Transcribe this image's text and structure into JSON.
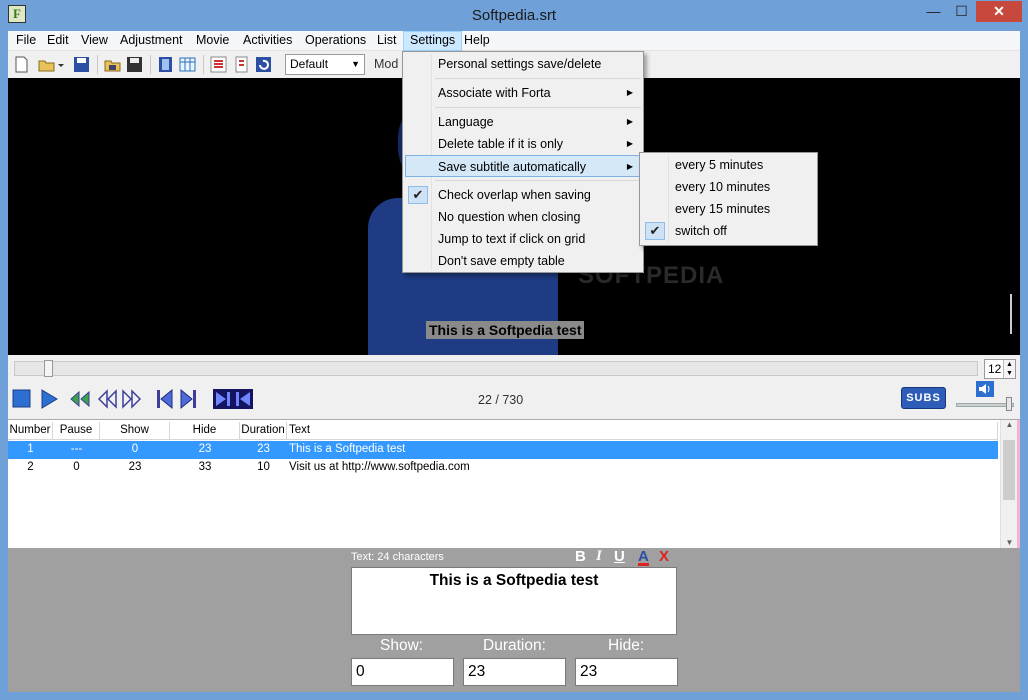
{
  "window": {
    "title": "Softpedia.srt",
    "app_icon": "F",
    "controls": {
      "minimize": "—",
      "maximize": "☐",
      "close": "✕"
    }
  },
  "menubar": {
    "items": [
      "File",
      "Edit",
      "View",
      "Adjustment",
      "Movie",
      "Activities",
      "Operations",
      "List",
      "Settings",
      "Help"
    ],
    "active": "Settings"
  },
  "toolbar": {
    "icons": [
      "new-file-icon",
      "open-folder-icon",
      "save-icon",
      "open-movie-icon",
      "save-as-icon",
      "film-icon",
      "table-icon",
      "list-icon",
      "list-small-icon",
      "undo-icon"
    ],
    "style_select": "Default",
    "mode_label": "Mod"
  },
  "video": {
    "caption": "This is a Softpedia test",
    "watermark": "SOFTPEDIA"
  },
  "seek": {
    "position_fraction": 0.035,
    "spin_value": "12"
  },
  "playback": {
    "counter": "22 / 730",
    "subs_label": "SUBS",
    "volume_fraction": 0.9,
    "icons": [
      "stop-icon",
      "play-icon",
      "step-icon",
      "prev-frame-icon",
      "next-frame-icon",
      "go-start-icon",
      "go-end-icon",
      "mark-in-icon",
      "mark-out-icon",
      "volume-icon"
    ]
  },
  "table": {
    "columns": [
      "Number",
      "Pause",
      "Show",
      "Hide",
      "Duration",
      "Text"
    ],
    "rows": [
      {
        "number": "1",
        "pause": "---",
        "show": "0",
        "hide": "23",
        "duration": "23",
        "text": "This is a Softpedia test",
        "selected": true
      },
      {
        "number": "2",
        "pause": "0",
        "show": "23",
        "hide": "33",
        "duration": "10",
        "text": "Visit us at http://www.softpedia.com",
        "selected": false
      }
    ]
  },
  "editor": {
    "char_count": "Text: 24 characters",
    "format_buttons": {
      "bold": "B",
      "italic": "I",
      "underline": "U",
      "color": "A",
      "clear": "X"
    },
    "text": "This is a Softpedia test",
    "show_label": "Show:",
    "duration_label": "Duration:",
    "hide_label": "Hide:",
    "show_value": "0",
    "duration_value": "23",
    "hide_value": "23"
  },
  "settings_menu": {
    "items": [
      {
        "label": "Personal settings save/delete",
        "submenu": false,
        "checked": false
      },
      {
        "label": "Associate with Forta",
        "submenu": true,
        "checked": false
      },
      {
        "label": "Language",
        "submenu": true,
        "checked": false
      },
      {
        "label": "Delete table if it is only",
        "submenu": true,
        "checked": false
      },
      {
        "label": "Save subtitle automatically",
        "submenu": true,
        "checked": false,
        "highlighted": true
      },
      {
        "label": "Check overlap when saving",
        "submenu": false,
        "checked": true
      },
      {
        "label": "No question when closing",
        "submenu": false,
        "checked": false
      },
      {
        "label": "Jump to text if click on grid",
        "submenu": false,
        "checked": false
      },
      {
        "label": "Don't save empty table",
        "submenu": false,
        "checked": false
      }
    ]
  },
  "autosave_submenu": {
    "items": [
      {
        "label": "every 5 minutes",
        "checked": false
      },
      {
        "label": "every 10 minutes",
        "checked": false
      },
      {
        "label": "every 15 minutes",
        "checked": false
      },
      {
        "label": "switch off",
        "checked": true
      }
    ]
  },
  "colors": {
    "title_bar": "#6fa0d8",
    "selection": "#3399ff",
    "menu_highlight": "#d5e8f7",
    "editor_bg": "#a0a0a0",
    "close_button": "#c7483c"
  }
}
